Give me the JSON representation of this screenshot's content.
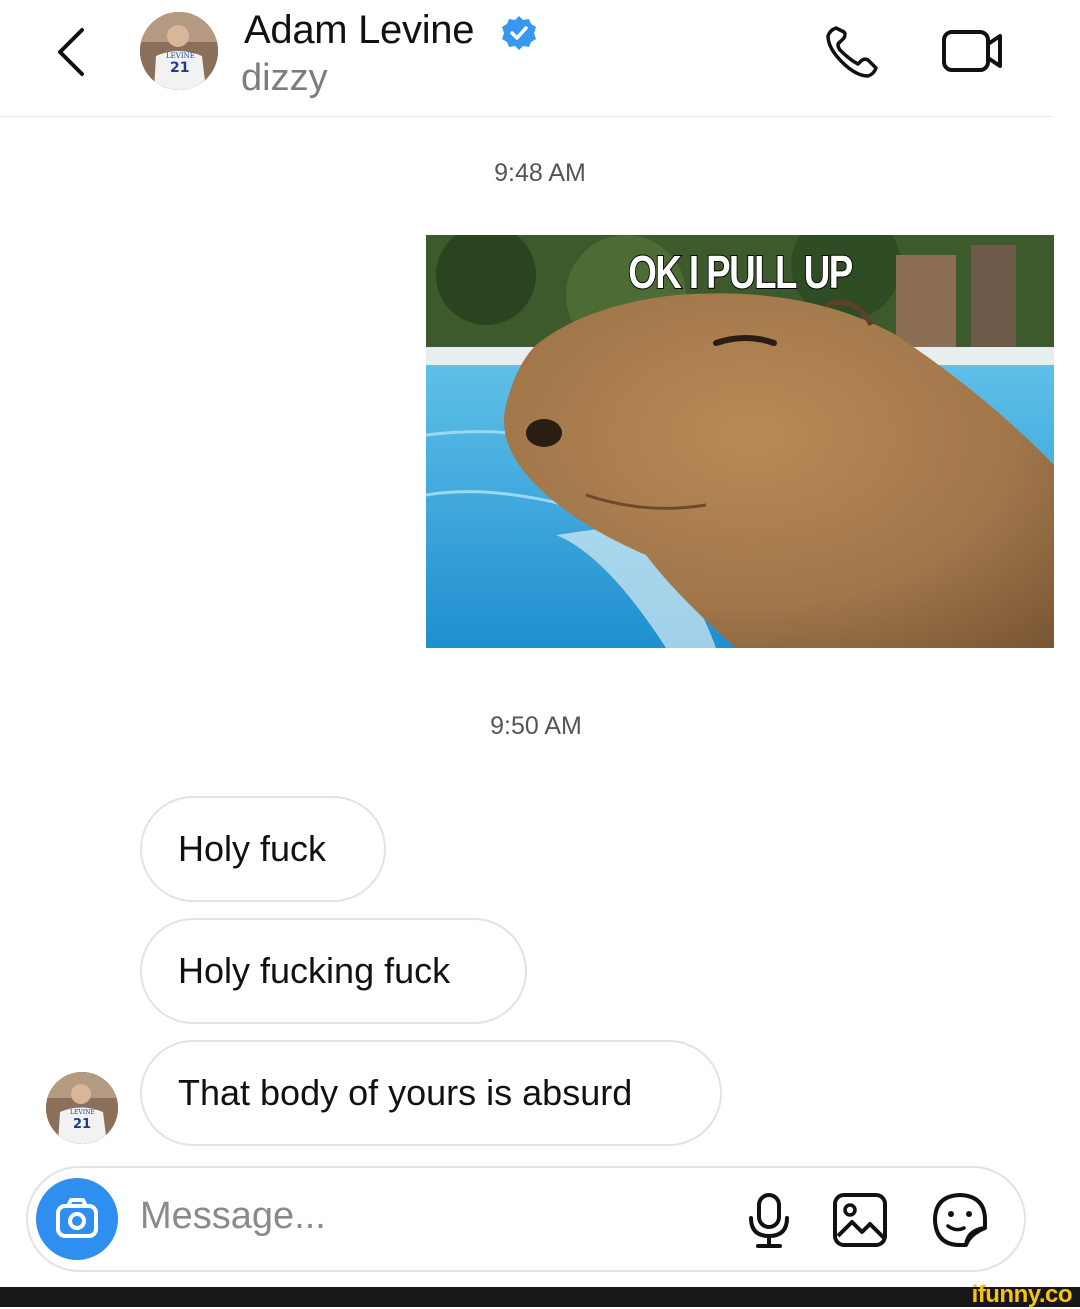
{
  "header": {
    "contact_name": "Adam Levine",
    "subtitle": "dizzy",
    "back_icon": "chevron-left-icon",
    "verified_icon": "verified-badge-icon",
    "call_icon": "phone-icon",
    "video_icon": "video-call-icon",
    "verified_color": "#3897f0"
  },
  "messages": {
    "timestamp_1": "9:48 AM",
    "meme_caption": "OK I PULL UP",
    "timestamp_2": "9:50 AM",
    "bubble_1": "Holy fuck",
    "bubble_2": "Holy fucking fuck",
    "bubble_3": "That body of yours is absurd"
  },
  "composer": {
    "placeholder": "Message...",
    "camera_icon": "camera-icon",
    "mic_icon": "microphone-icon",
    "gallery_icon": "gallery-icon",
    "sticker_icon": "sticker-icon",
    "camera_color": "#2f8ff0"
  },
  "watermark": "ifunny.co"
}
